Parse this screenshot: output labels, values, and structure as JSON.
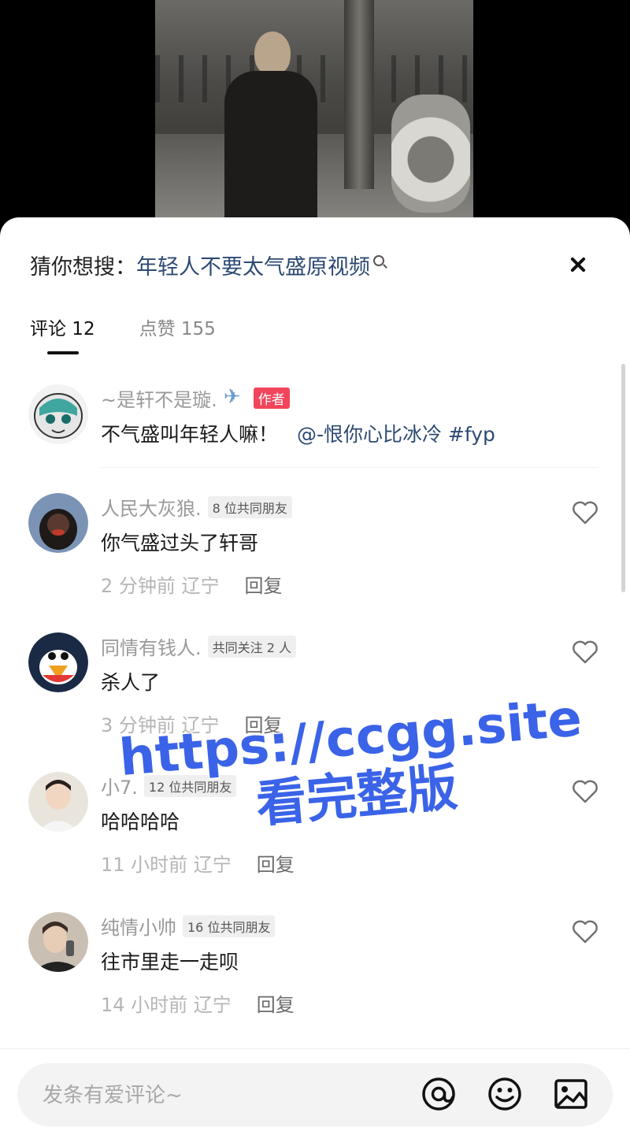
{
  "search": {
    "prefix": "猜你想搜：",
    "term": "年轻人不要太气盛原视频"
  },
  "tabs": [
    {
      "label": "评论 12"
    },
    {
      "label": "点赞 155"
    }
  ],
  "comments": [
    {
      "name": "~是轩不是璇.",
      "badge": "作者",
      "text": "不气盛叫年轻人嘛！",
      "mention": "@-恨你心比冰冷 #fyp"
    },
    {
      "name": "人民大灰狼.",
      "badge": "8 位共同朋友",
      "text": "你气盛过头了轩哥",
      "time": "2 分钟前  辽宁",
      "reply": "回复"
    },
    {
      "name": "同情有钱人.",
      "badge": "共同关注 2 人",
      "text": "杀人了",
      "time": "3 分钟前  辽宁",
      "reply": "回复"
    },
    {
      "name": "小7.",
      "badge": "12 位共同朋友",
      "text": "哈哈哈哈",
      "time": "11 小时前  辽宁",
      "reply": "回复"
    },
    {
      "name": "纯情小帅",
      "badge": "16 位共同朋友",
      "text": "往市里走一走呗",
      "time": "14 小时前  辽宁",
      "reply": "回复"
    }
  ],
  "watermark": {
    "line1": "https://ccgg.site",
    "line2": "看完整版",
    "color": "#3a63e8"
  },
  "input": {
    "placeholder": "发条有爱评论~"
  },
  "colors": {
    "author_badge": "#f2445a",
    "link": "#2d4a73"
  }
}
